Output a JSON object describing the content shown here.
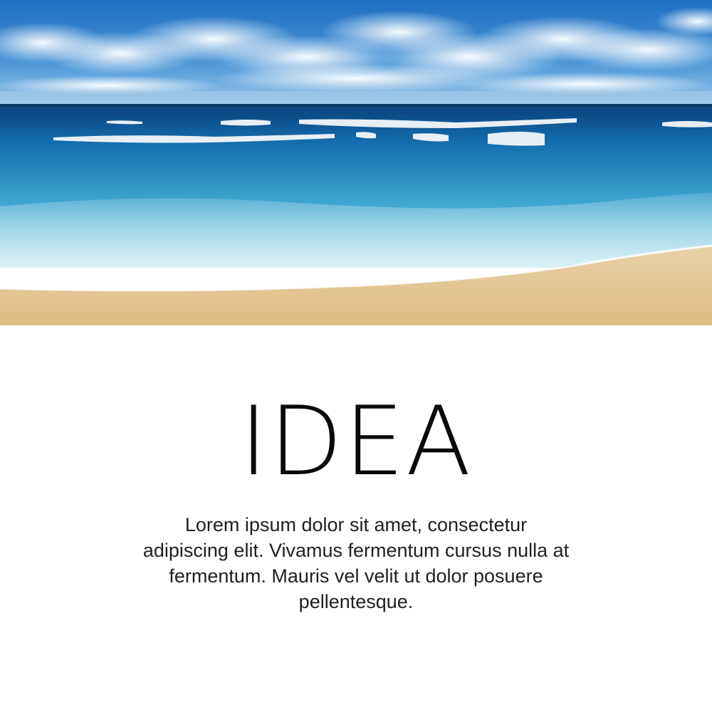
{
  "hero": {
    "scene": "beach-photo",
    "colors": {
      "sky_top": "#1e6fc2",
      "sky_bottom": "#6fb2e4",
      "ocean_deep": "#0b4f8f",
      "ocean_light": "#4fb6d6",
      "sand": "#e6c795"
    }
  },
  "heading": {
    "text": "IDEA"
  },
  "body": {
    "text": "Lorem ipsum dolor sit amet, consectetur adipiscing elit. Vivamus fermentum cursus nulla at fermentum. Mauris vel velit ut dolor posuere pellentesque."
  }
}
